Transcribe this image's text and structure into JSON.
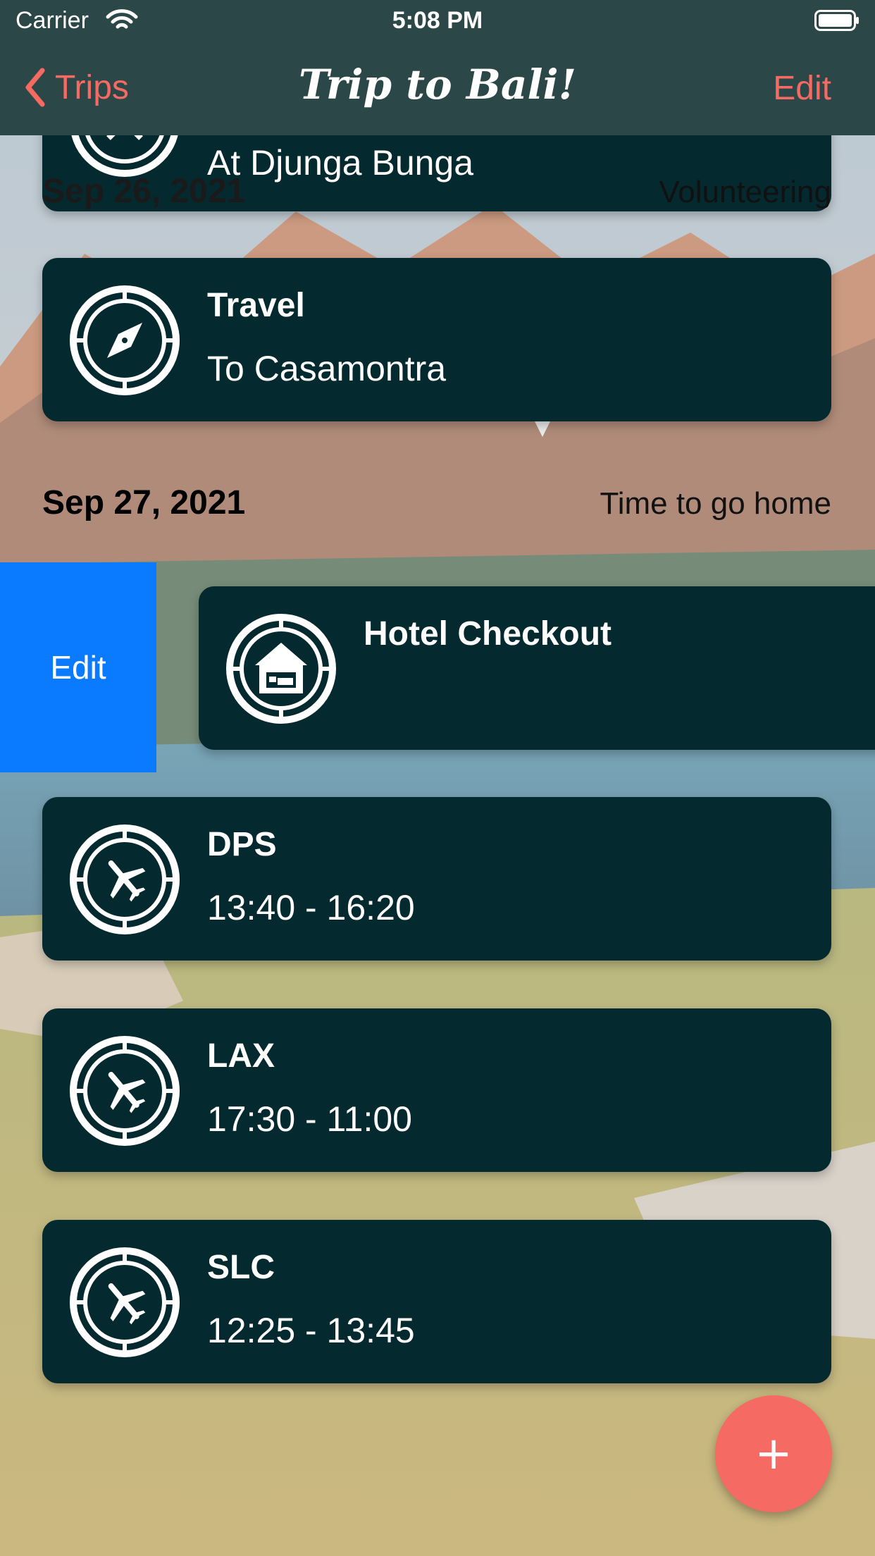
{
  "status_bar": {
    "carrier": "Carrier",
    "time": "5:08 PM"
  },
  "nav": {
    "back_label": "Trips",
    "title": "Trip to Bali!",
    "edit_label": "Edit"
  },
  "items": {
    "partial": {
      "subtitle": "At Djunga Bunga"
    },
    "day1": {
      "date": "Sep 26, 2021",
      "note": "Volunteering"
    },
    "travel": {
      "title": "Travel",
      "subtitle": "To Casamontra",
      "icon": "compass-icon"
    },
    "day2": {
      "date": "Sep 27, 2021",
      "note": "Time to go home"
    },
    "hotel": {
      "title": "Hotel Checkout",
      "icon": "hotel-icon",
      "swipe_action": "Edit"
    },
    "flights": [
      {
        "title": "DPS",
        "subtitle": "13:40 - 16:20",
        "icon": "airplane-icon"
      },
      {
        "title": "LAX",
        "subtitle": "17:30 - 11:00",
        "icon": "airplane-icon"
      },
      {
        "title": "SLC",
        "subtitle": "12:25 - 13:45",
        "icon": "airplane-icon"
      }
    ]
  },
  "fab": {
    "label": "+"
  },
  "colors": {
    "nav_bg": "#2c4747",
    "accent": "#f56a63",
    "card_bg": "#04292e",
    "swipe_edit": "#0a7aff"
  }
}
